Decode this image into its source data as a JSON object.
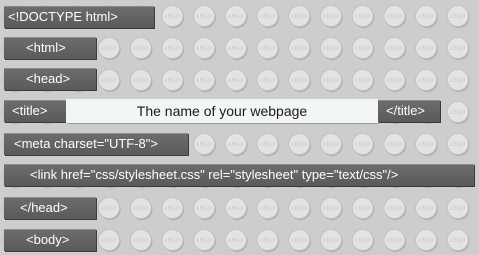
{
  "bricks": {
    "doctype": "<!DOCTYPE html>",
    "html_open": "<html>",
    "head_open": "<head>",
    "title_open": "<title>",
    "title_text": "The name of your webpage",
    "title_close": "</title>",
    "meta": "<meta charset=\"UTF-8\">",
    "link": "<link href=\"css/stylesheet.css\" rel=\"stylesheet\" type=\"text/css\"/>",
    "head_close": "</head>",
    "body_open": "<body>"
  },
  "stud_label": "LEGO",
  "colors": {
    "dark_brick": "#5f5f5f",
    "light_brick": "#f3f6f7",
    "baseplate": "#cdcdcd",
    "stud": "#e3e3e3"
  }
}
